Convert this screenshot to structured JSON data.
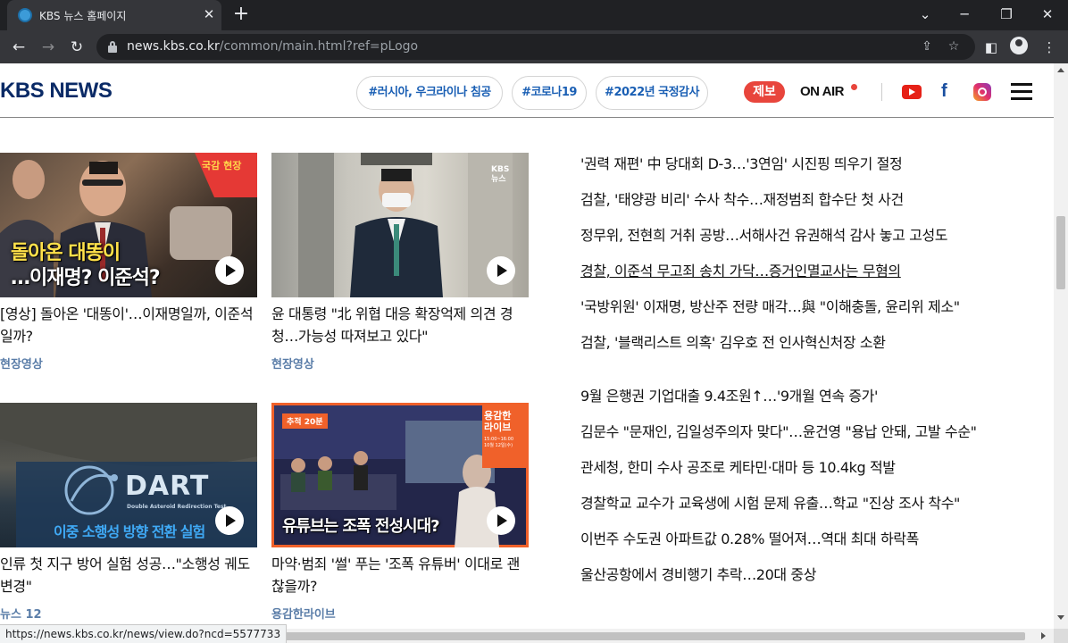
{
  "browser": {
    "tab_title": "KBS 뉴스 홈페이지",
    "tab_close": "✕",
    "new_tab": "+",
    "url_host": "news.kbs.co.kr",
    "url_path": "/common/main.html?ref=pLogo",
    "status_url": "https://news.kbs.co.kr/news/view.do?ncd=5577733"
  },
  "header": {
    "logo": "KBS NEWS",
    "hashtags": [
      "#러시아, 우크라이나 침공",
      "#코로나19",
      "#2022년 국정감사"
    ],
    "tip_label": "제보",
    "onair_label": "ON AIR",
    "facebook_glyph": "f"
  },
  "cards": [
    {
      "caption_line1": "돌아온 대똥이",
      "caption_line2": "…이재명? 이준석?",
      "corner_badge": "국감 현장",
      "title": "[영상] 돌아온 '대똥이'…이재명일까, 이준석일까?",
      "category": "현장영상"
    },
    {
      "title": "윤 대통령 \"北 위협 대응 확장억제 의견 경청…가능성 따져보고 있다\"",
      "category": "현장영상",
      "corner_badge": "KBS 뉴스"
    },
    {
      "caption_line1": "DART",
      "caption_sub": "Double Asteroid Redirection Test",
      "caption_line2": "이중 소행성 방향 전환 실험",
      "title": "인류 첫 지구 방어 실험 성공…\"소행성 궤도 변경\"",
      "category": "뉴스 12"
    },
    {
      "caption_line1": "유튜브는 조폭 전성시대?",
      "tag_left": "추적 20분",
      "tag_right_line1": "용감한",
      "tag_right_line2": "라이브",
      "tag_right_time": "15:00~16:00",
      "tag_right_date": "10월 12일(수)",
      "title": "마약·범죄 '썰' 푸는 '조폭 유튜버' 이대로 괜찮을까?",
      "category": "용감한라이브"
    }
  ],
  "headlines": [
    "'권력 재편' 中 당대회 D-3…'3연임' 시진핑 띄우기 절정",
    "검찰, '태양광 비리' 수사 착수…재정범죄 합수단 첫 사건",
    "정무위, 전현희 거취 공방…서해사건 유권해석 감사 놓고 고성도",
    "경찰, 이준석 무고죄 송치 가닥…증거인멸교사는 무혐의",
    "'국방위원' 이재명, 방산주 전량 매각…與 \"이해충돌, 윤리위 제소\"",
    "검찰, '블랙리스트 의혹' 김우호 전 인사혁신처장 소환",
    "9월 은행권 기업대출 9.4조원↑…'9개월 연속 증가'",
    "김문수 \"문재인, 김일성주의자 맞다\"…윤건영 \"용납 안돼, 고발 수순\"",
    "관세청, 한미 수사 공조로 케타민·대마 등 10.4kg 적발",
    "경찰학교 교수가 교육생에 시험 문제 유출…학교 \"진상 조사 착수\"",
    "이번주 수도권 아파트값 0.28% 떨어져…역대 최대 하락폭",
    "울산공항에서 경비행기 추락…20대 중상"
  ],
  "colors": {
    "brand_navy": "#0a2a66",
    "hashtag_blue": "#1a5fb4",
    "tip_red": "#e8453c",
    "category_blue": "#5a7da8"
  }
}
